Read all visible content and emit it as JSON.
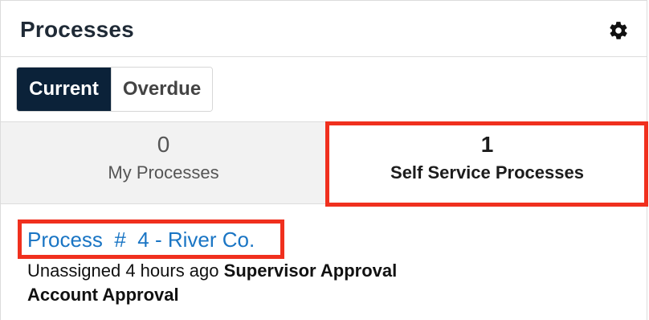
{
  "header": {
    "title": "Processes",
    "settings_icon": "gear-icon"
  },
  "tabs": [
    {
      "label": "Current",
      "active": true
    },
    {
      "label": "Overdue",
      "active": false
    }
  ],
  "counts": {
    "my_processes": {
      "value": "0",
      "label": "My Processes"
    },
    "self_service": {
      "value": "1",
      "label": "Self Service Processes"
    }
  },
  "records": [
    {
      "link": "Process  #  4 - River Co.",
      "assigned": "Unassigned",
      "time": "4 hours ago",
      "step": "Supervisor Approval",
      "process_name": "Account Approval"
    }
  ],
  "colors": {
    "active_tab_bg": "#0b2239",
    "link": "#1a75c4",
    "highlight": "#f0301e"
  }
}
